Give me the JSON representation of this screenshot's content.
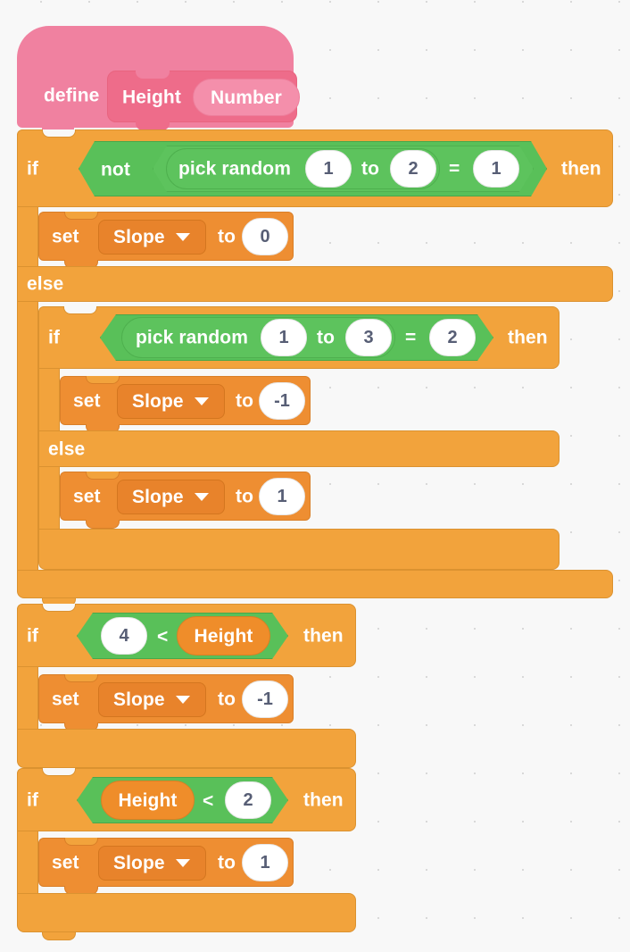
{
  "editor": {
    "background_color": "#F8F8F8",
    "grid_dot_color": "#D9D9D9"
  },
  "palette": {
    "control": "#F2A33C",
    "control_stroke": "#DB9230",
    "operators": "#59C059",
    "variables": "#EE8E32",
    "custom_block": "#F081A0",
    "input_text": "#575E75"
  },
  "script": {
    "definition": {
      "define_label": "define",
      "block_name": "Height",
      "argument_label": "Number"
    },
    "if_1": {
      "if_label": "if",
      "then_label": "then",
      "else_label": "else",
      "condition": {
        "not_label": "not",
        "operator_label": "=",
        "pick_random": {
          "pick_random_label": "pick random",
          "to_label": "to",
          "from": "1",
          "upto": "2"
        },
        "compare_value": "1"
      },
      "then_body": {
        "set_label": "set",
        "variable": "Slope",
        "to_label": "to",
        "value": "0"
      },
      "else_body": {
        "if_label": "if",
        "then_label": "then",
        "else_label": "else",
        "condition": {
          "operator_label": "=",
          "pick_random": {
            "pick_random_label": "pick random",
            "to_label": "to",
            "from": "1",
            "upto": "3"
          },
          "compare_value": "2"
        },
        "then_body": {
          "set_label": "set",
          "variable": "Slope",
          "to_label": "to",
          "value": "-1"
        },
        "else_body": {
          "set_label": "set",
          "variable": "Slope",
          "to_label": "to",
          "value": "1"
        }
      }
    },
    "if_2": {
      "if_label": "if",
      "then_label": "then",
      "condition": {
        "left_value": "4",
        "operator_label": "<",
        "right_variable": "Height"
      },
      "body": {
        "set_label": "set",
        "variable": "Slope",
        "to_label": "to",
        "value": "-1"
      }
    },
    "if_3": {
      "if_label": "if",
      "then_label": "then",
      "condition": {
        "left_variable": "Height",
        "operator_label": "<",
        "right_value": "2"
      },
      "body": {
        "set_label": "set",
        "variable": "Slope",
        "to_label": "to",
        "value": "1"
      }
    }
  }
}
